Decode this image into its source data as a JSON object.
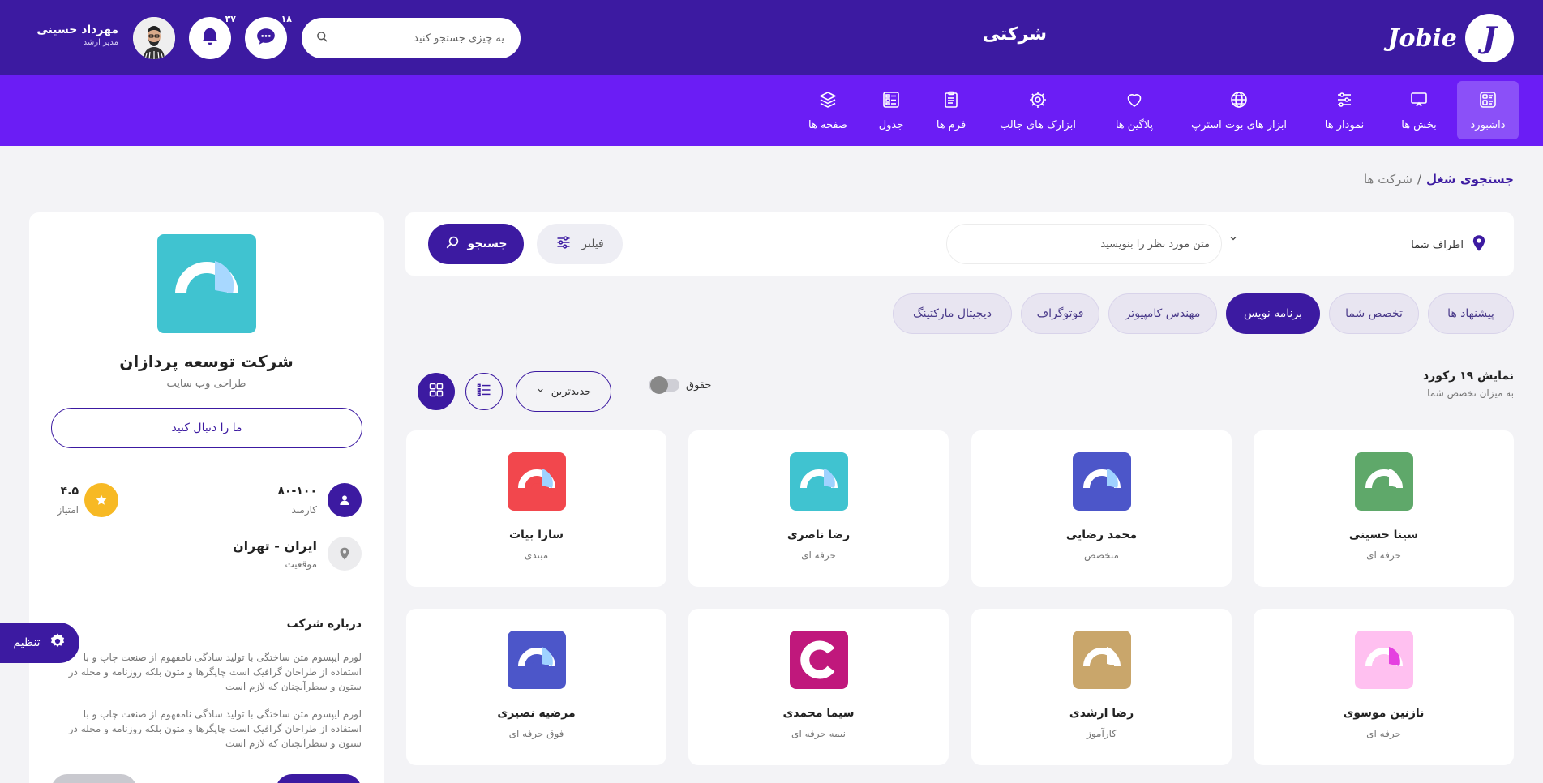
{
  "header": {
    "brand": "Jobie",
    "brand_mark": "J",
    "title": "شرکتی",
    "search_placeholder": "یه چیزی جستجو کنید",
    "messages_count": "۱۸",
    "notifications_count": "۳۷",
    "user_name": "مهرداد حسینی",
    "user_role": "مدیر ارشد",
    "icons": {
      "search": "search-icon",
      "messages": "chat-icon",
      "notifications": "bell-icon"
    }
  },
  "nav": {
    "items": [
      {
        "label": "داشبورد",
        "icon": "dashboard-icon",
        "active": true
      },
      {
        "label": "بخش ها",
        "icon": "monitor-icon"
      },
      {
        "label": "نمودار ها",
        "icon": "sliders-icon"
      },
      {
        "label": "ابزار های بوت استرپ",
        "icon": "globe-icon"
      },
      {
        "label": "پلاگین ها",
        "icon": "heart-icon"
      },
      {
        "label": "ابزارک های جالب",
        "icon": "gear-icon"
      },
      {
        "label": "فرم ها",
        "icon": "clipboard-icon"
      },
      {
        "label": "جدول",
        "icon": "table-icon"
      },
      {
        "label": "صفحه ها",
        "icon": "layers-icon"
      }
    ]
  },
  "breadcrumb": {
    "current": "جستجوی شغل",
    "separator": "/",
    "parent": "شرکت ها"
  },
  "search": {
    "location_label": "اطراف شما",
    "keyword_placeholder": "متن مورد نظر را بنویسید",
    "filter_label": "فیلتر",
    "search_label": "جستجو"
  },
  "tabs": [
    {
      "label": "پیشنهاد ها"
    },
    {
      "label": "تخصص شما"
    },
    {
      "label": "برنامه نویس",
      "active": true
    },
    {
      "label": "مهندس کامپیوتر"
    },
    {
      "label": "فوتوگراف"
    },
    {
      "label": "دیجیتال مارکتینگ"
    }
  ],
  "results": {
    "title": "نمایش ۱۹ رکورد",
    "subtitle": "به میزان تخصص شما",
    "salary_toggle_label": "حقوق",
    "sort_label": "جدیدترین"
  },
  "candidates": [
    {
      "name": "سینا حسینی",
      "level": "حرفه ای",
      "color": "#5fa86a",
      "accent": "#ffffff"
    },
    {
      "name": "محمد رضایی",
      "level": "متخصص",
      "color": "#4c56c9",
      "accent": "#9fd2ff"
    },
    {
      "name": "رضا ناصری",
      "level": "حرفه ای",
      "color": "#40c3d0",
      "accent": "#9fd2ff"
    },
    {
      "name": "سارا بیات",
      "level": "مبتدی",
      "color": "#f2474d",
      "accent": "#9fd2ff"
    },
    {
      "name": "نازنین موسوی",
      "level": "حرفه ای",
      "color": "#ffc0f0",
      "accent": "#e540e0"
    },
    {
      "name": "رضا ارشدی",
      "level": "کارآموز",
      "color": "#c9a66b",
      "accent": "#ffffff"
    },
    {
      "name": "سیما محمدی",
      "level": "نیمه حرفه ای",
      "color": "#c0187c",
      "accent": "#ffffff"
    },
    {
      "name": "مرضیه نصیری",
      "level": "فوق حرفه ای",
      "color": "#4c56c9",
      "accent": "#9fd2ff"
    }
  ],
  "company": {
    "name": "شرکت توسعه پردازان",
    "subtitle": "طراحی وب سایت",
    "follow_label": "ما را دنبال کنید",
    "employees_value": "۸۰-۱۰۰",
    "employees_label": "کارمند",
    "rating_value": "۴.۵",
    "rating_label": "امتیاز",
    "location_value": "ایران - تهران",
    "location_label": "موقعیت",
    "about_title": "درباره شرکت",
    "about_p1": "لورم ایپسوم متن ساختگی با تولید سادگی نامفهوم از صنعت چاپ و با استفاده از طراحان گرافیک است چاپگرها و متون بلکه روزنامه و مجله در ستون و سطرآنچنان که لازم است",
    "about_p2": "لورم ایپسوم متن ساختگی با تولید سادگی نامفهوم از صنعت چاپ و با استفاده از طراحان گرافیک است چاپگرها و متون بلکه روزنامه و مجله در ستون و سطرآنچنان که لازم است",
    "logo_color": "#40c3d0",
    "rating_color": "#f7b924"
  },
  "settings_label": "تنظیم",
  "colors": {
    "primary": "#3c1aa1",
    "nav": "#6b1df5",
    "nav_active": "#8b50f8",
    "background": "#f3f3f6"
  }
}
